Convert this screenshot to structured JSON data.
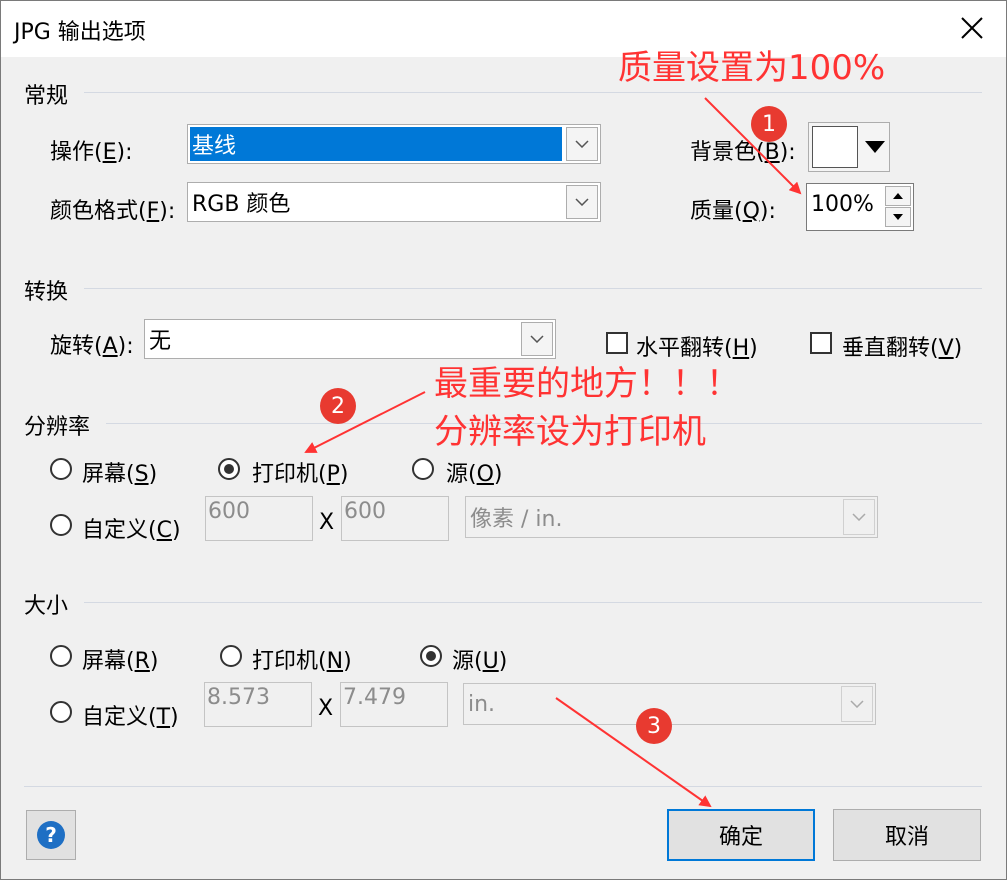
{
  "window": {
    "title": "JPG 输出选项"
  },
  "general": {
    "heading": "常规",
    "operation_label": "操作(",
    "operation_key": "E",
    "operation_suffix": "):",
    "operation_value": "基线",
    "color_format_label": "颜色格式(",
    "color_format_key": "F",
    "color_format_suffix": "):",
    "color_format_value": "RGB 颜色",
    "background_label": "背景色(",
    "background_key": "B",
    "background_suffix": "):",
    "background_color": "#ffffff",
    "quality_label": "质量(",
    "quality_key": "Q",
    "quality_suffix": "):",
    "quality_value": "100%"
  },
  "transform": {
    "heading": "转换",
    "rotation_label": "旋转(",
    "rotation_key": "A",
    "rotation_suffix": "):",
    "rotation_value": "无",
    "flip_h_label": "水平翻转(",
    "flip_h_key": "H",
    "flip_h_suffix": ")",
    "flip_h_checked": false,
    "flip_v_label": "垂直翻转(",
    "flip_v_key": "V",
    "flip_v_suffix": ")",
    "flip_v_checked": false
  },
  "resolution": {
    "heading": "分辨率",
    "screen_label": "屏幕(",
    "screen_key": "S",
    "screen_suffix": ")",
    "printer_label": "打印机(",
    "printer_key": "P",
    "printer_suffix": ")",
    "source_label": "源(",
    "source_key": "O",
    "source_suffix": ")",
    "custom_label": "自定义(",
    "custom_key": "C",
    "custom_suffix": ")",
    "selected": "printer",
    "x_value": "600",
    "separator": "X",
    "y_value": "600",
    "unit": "像素 / in."
  },
  "size": {
    "heading": "大小",
    "screen_label": "屏幕(",
    "screen_key": "R",
    "screen_suffix": ")",
    "printer_label": "打印机(",
    "printer_key": "N",
    "printer_suffix": ")",
    "source_label": "源(",
    "source_key": "U",
    "source_suffix": ")",
    "custom_label": "自定义(",
    "custom_key": "T",
    "custom_suffix": ")",
    "selected": "source",
    "width_value": "8.573",
    "separator": "X",
    "height_value": "7.479",
    "unit": "in."
  },
  "buttons": {
    "help": "?",
    "ok": "确定",
    "cancel": "取消"
  },
  "annotations": {
    "quality_note": "质量设置为100%",
    "important_note_line1": "最重要的地方！！！",
    "important_note_line2": "分辨率设为打印机",
    "badge1": "1",
    "badge2": "2",
    "badge3": "3",
    "color": "#ff3333"
  },
  "colors": {
    "accent": "#0078d7",
    "dialog_bg": "#f0f0f0"
  }
}
